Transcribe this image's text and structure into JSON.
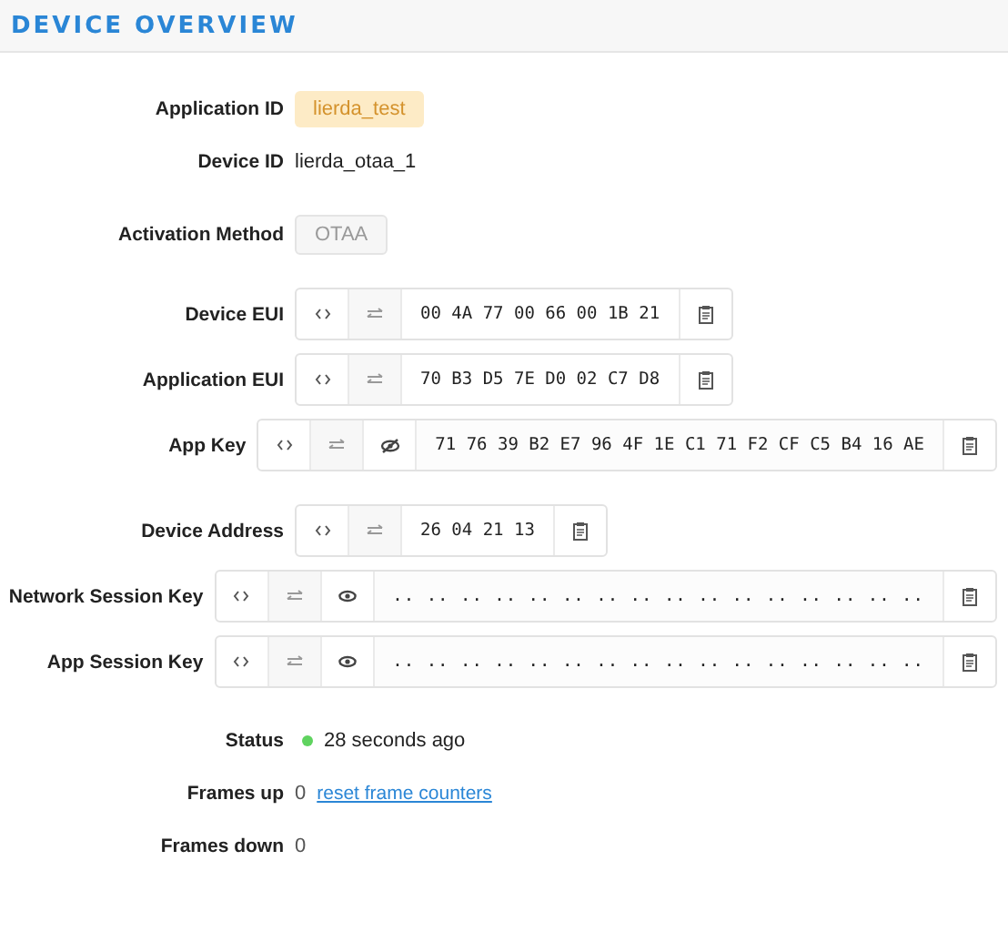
{
  "header": {
    "title": "DEVICE OVERVIEW"
  },
  "sections": [
    {
      "rows": [
        {
          "label": "Application ID",
          "kind": "badge",
          "value": "lierda_test"
        },
        {
          "label": "Device ID",
          "kind": "plain",
          "value": "lierda_otaa_1"
        }
      ]
    },
    {
      "rows": [
        {
          "label": "Activation Method",
          "kind": "tag",
          "value": "OTAA"
        }
      ]
    },
    {
      "rows": [
        {
          "label": "Device EUI",
          "kind": "key",
          "value": "00 4A 77 00 66 00 1B 21"
        },
        {
          "label": "Application EUI",
          "kind": "key",
          "value": "70 B3 D5 7E D0 02 C7 D8"
        },
        {
          "label": "App Key",
          "kind": "key",
          "visible": true,
          "value": "71 76 39 B2 E7 96 4F 1E C1 71 F2 CF C5 B4 16 AE"
        }
      ]
    },
    {
      "rows": [
        {
          "label": "Device Address",
          "kind": "key",
          "value": "26 04 21 13"
        },
        {
          "label": "Network Session Key",
          "kind": "key",
          "visible": false,
          "value": ".. .. .. .. .. .. .. .. .. .. .. .. .. .. .. .."
        },
        {
          "label": "App Session Key",
          "kind": "key",
          "visible": false,
          "value": ".. .. .. .. .. .. .. .. .. .. .. .. .. .. .. .."
        }
      ]
    },
    {
      "rows": [
        {
          "label": "Status",
          "kind": "status",
          "color": "#5fd35f",
          "value": "28 seconds ago"
        },
        {
          "label": "Frames up",
          "kind": "counter",
          "value": "0",
          "link": "reset frame counters"
        },
        {
          "label": "Frames down",
          "kind": "counter",
          "value": "0"
        }
      ]
    }
  ]
}
